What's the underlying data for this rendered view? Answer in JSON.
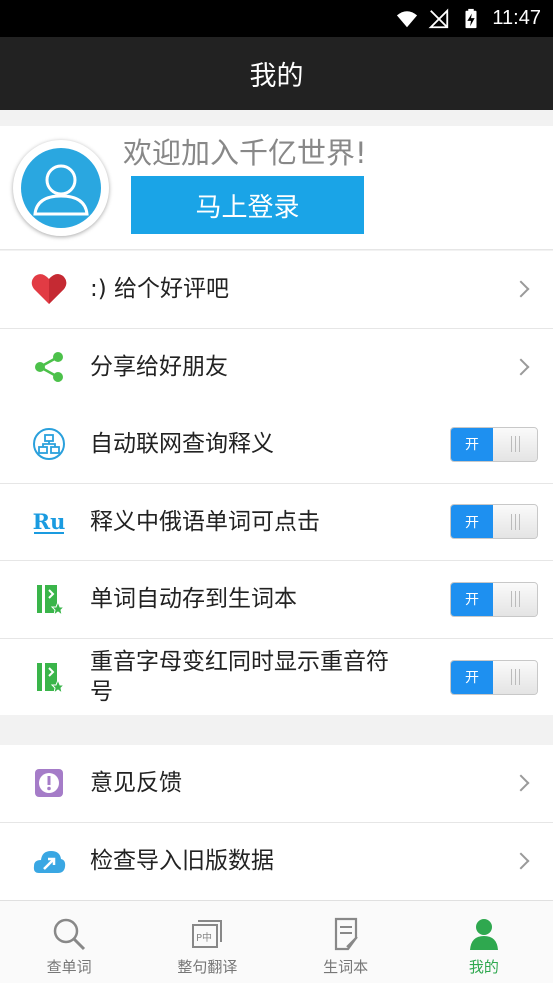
{
  "status_bar": {
    "time": "11:47"
  },
  "header": {
    "title": "我的"
  },
  "profile": {
    "welcome": "欢迎加入千亿世界!",
    "login_label": "马上登录"
  },
  "list_group_1": [
    {
      "label": ":) 给个好评吧",
      "icon": "heart-icon",
      "type": "link"
    },
    {
      "label": "分享给好朋友",
      "icon": "share-icon",
      "type": "link"
    }
  ],
  "list_group_2": [
    {
      "label": "自动联网查询释义",
      "icon": "network-icon",
      "type": "toggle",
      "toggle_label": "开"
    },
    {
      "label": "释义中俄语单词可点击",
      "icon": "ru-icon",
      "icon_text": "Ru",
      "type": "toggle",
      "toggle_label": "开"
    },
    {
      "label": "单词自动存到生词本",
      "icon": "wordbook-icon",
      "type": "toggle",
      "toggle_label": "开"
    },
    {
      "label": "重音字母变红同时显示重音符号",
      "icon": "wordbook-icon",
      "type": "toggle",
      "toggle_label": "开"
    }
  ],
  "list_group_3": [
    {
      "label": "意见反馈",
      "icon": "feedback-icon",
      "type": "link"
    },
    {
      "label": "检查导入旧版数据",
      "icon": "import-icon",
      "type": "link"
    }
  ],
  "bottom_nav": [
    {
      "label": "查单词",
      "icon": "search-icon",
      "active": false
    },
    {
      "label": "整句翻译",
      "icon": "translate-icon",
      "active": false
    },
    {
      "label": "生词本",
      "icon": "notebook-icon",
      "active": false
    },
    {
      "label": "我的",
      "icon": "person-icon",
      "active": true
    }
  ],
  "colors": {
    "accent_blue": "#1aa4e7",
    "toggle_blue": "#1e90f0",
    "active_green": "#2fa84f",
    "header_bg": "#222222"
  }
}
